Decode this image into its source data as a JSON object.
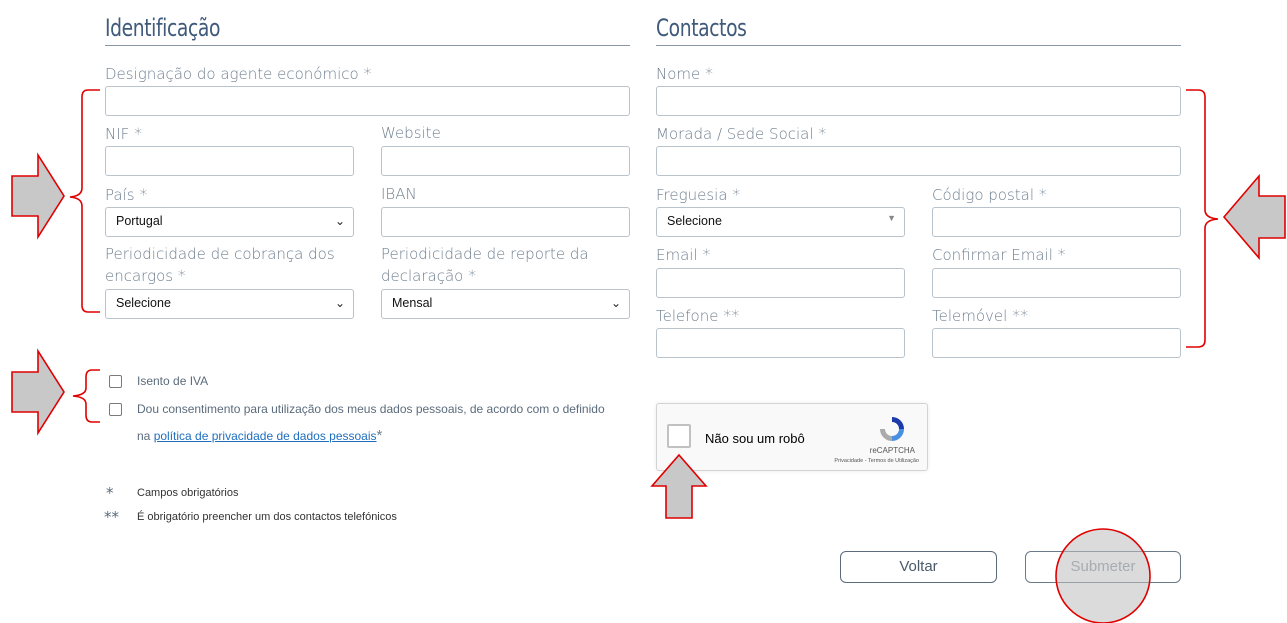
{
  "identificacao": {
    "title": "Identificação",
    "designacao_label": "Designação do agente económico",
    "nif_label": "NIF",
    "website_label": "Website",
    "pais_label": "País",
    "pais_value": "Portugal",
    "iban_label": "IBAN",
    "periodicidade_cobranca_label_1": "Periodicidade de cobrança dos",
    "periodicidade_cobranca_label_2": "encargos",
    "periodicidade_cobranca_value": "Selecione",
    "periodicidade_reporte_label_1": "Periodicidade de reporte da",
    "periodicidade_reporte_label_2": "declaração",
    "periodicidade_reporte_value": "Mensal"
  },
  "contactos": {
    "title": "Contactos",
    "nome_label": "Nome",
    "morada_label": "Morada / Sede Social",
    "freguesia_label": "Freguesia",
    "freguesia_value": "Selecione",
    "codigo_postal_label": "Código postal",
    "email_label": "Email",
    "confirmar_email_label": "Confirmar Email",
    "telefone_label": "Telefone",
    "telemovel_label": "Telemóvel"
  },
  "marks": {
    "required": "*",
    "phone_required": "**"
  },
  "checkboxes": {
    "isento_iva": "Isento de IVA",
    "consent_text": "Dou consentimento para utilização dos meus dados pessoais, de acordo com o definido",
    "consent_prefix": "na",
    "consent_link": "política de privacidade de dados pessoais"
  },
  "legend": {
    "single_star_text": "Campos obrigatórios",
    "double_star_text": "É obrigatório preencher um dos contactos telefónicos"
  },
  "captcha": {
    "label": "Não sou um robô",
    "brand": "reCAPTCHA",
    "links": "Privacidade - Termos de Utilização"
  },
  "buttons": {
    "back": "Voltar",
    "submit": "Submeter"
  },
  "colors": {
    "annotation_red": "#e00000",
    "arrow_fill": "#c8c8c8",
    "title_blue": "#3f5a7a"
  }
}
